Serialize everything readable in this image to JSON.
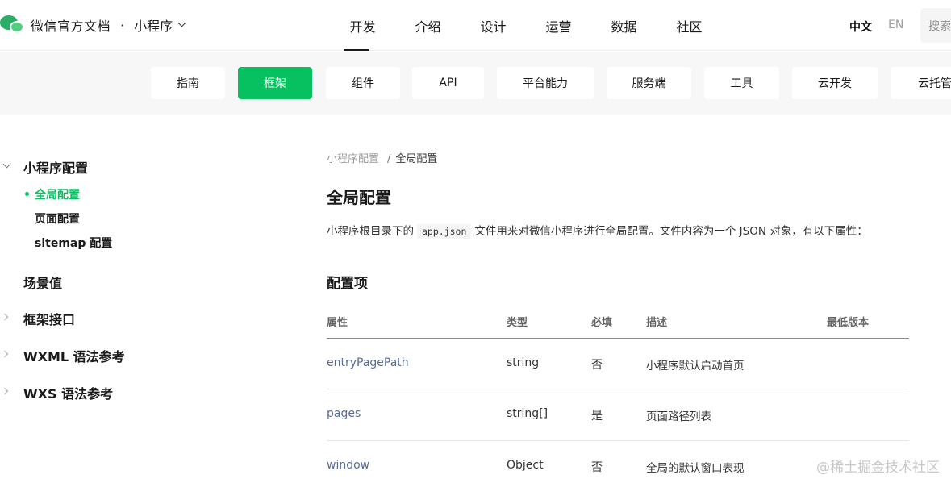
{
  "header": {
    "brand_title": "微信官方文档",
    "brand_sep": "·",
    "brand_sub": "小程序",
    "nav": [
      "开发",
      "介绍",
      "设计",
      "运营",
      "数据",
      "社区"
    ],
    "lang_zh": "中文",
    "lang_en": "EN",
    "search_placeholder": "搜索"
  },
  "subnav": [
    "指南",
    "框架",
    "组件",
    "API",
    "平台能力",
    "服务端",
    "工具",
    "云开发",
    "云托管"
  ],
  "sidebar": {
    "groups": [
      "小程序配置",
      "场景值",
      "框架接口",
      "WXML 语法参考",
      "WXS 语法参考"
    ],
    "items": [
      "全局配置",
      "页面配置",
      "sitemap 配置"
    ]
  },
  "content": {
    "breadcrumb_parent": "小程序配置",
    "breadcrumb_sep": "/",
    "breadcrumb_current": "全局配置",
    "title": "全局配置",
    "intro_before": "小程序根目录下的",
    "intro_code": "app.json",
    "intro_after": "文件用来对微信小程序进行全局配置。文件内容为一个 JSON 对象，有以下属性：",
    "section_title": "配置项",
    "table": {
      "headers": [
        "属性",
        "类型",
        "必填",
        "描述",
        "最低版本"
      ],
      "rows": [
        [
          "entryPagePath",
          "string",
          "否",
          "小程序默认启动首页",
          ""
        ],
        [
          "pages",
          "string[]",
          "是",
          "页面路径列表",
          ""
        ],
        [
          "window",
          "Object",
          "否",
          "全局的默认窗口表现",
          ""
        ]
      ]
    }
  },
  "watermark": "@稀土掘金技术社区"
}
